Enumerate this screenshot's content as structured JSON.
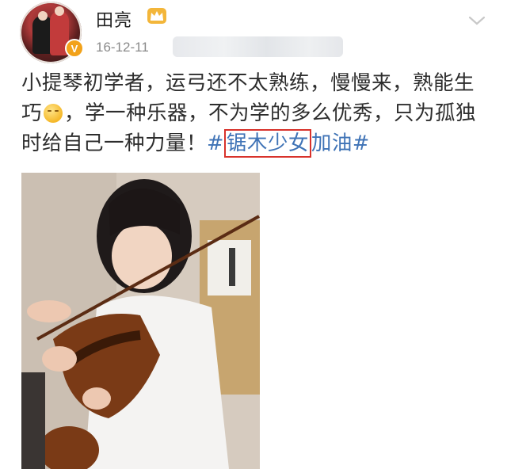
{
  "post": {
    "author": {
      "name": "田亮",
      "verified_badge": "V",
      "avatar_icon": "avatar-photo",
      "badge_icon": "crown-icon"
    },
    "date": "16-12-11",
    "more_icon": "chevron-down-icon",
    "text": {
      "line1": "小提琴初学者，运弓还不太熟练，慢慢来，熟能生",
      "line2_a": "巧",
      "line2_b": "，学一种乐器，不为学的多么优秀，只为孤独",
      "line3_a": "时给自己一种力量！",
      "hashtag_open": "#",
      "hashtag_highlighted": "锯木少女",
      "hashtag_rest": "加油#"
    },
    "emoji_icon": "crying-laughing-emoji-icon",
    "photo_icon": "girl-playing-violin-photo"
  },
  "colors": {
    "hashtag": "#3f73b6",
    "highlight_box": "#d8322b",
    "text": "#2d2d2d",
    "date": "#8a8a8a"
  }
}
